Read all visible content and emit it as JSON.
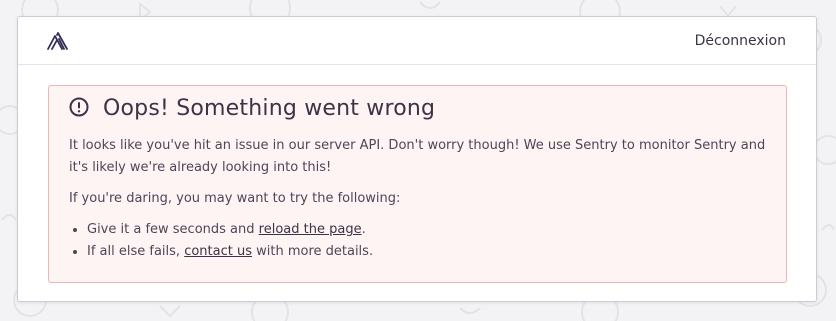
{
  "header": {
    "logo_icon": "sentry-logo-icon",
    "logout_label": "Déconnexion"
  },
  "alert": {
    "icon": "exclamation-circle-icon",
    "title": "Oops! Something went wrong",
    "paragraph1": "It looks like you've hit an issue in our server API. Don't worry though! We use Sentry to monitor Sentry and it's likely we're already looking into this!",
    "paragraph2": "If you're daring, you may want to try the following:",
    "items": [
      {
        "before": "Give it a few seconds and ",
        "link": "reload the page",
        "after": "."
      },
      {
        "before": "If all else fails, ",
        "link": "contact us",
        "after": " with more details."
      }
    ]
  },
  "colors": {
    "background": "#f3f2f4",
    "card": "#ffffff",
    "alert_bg": "#fdf4f3",
    "alert_border": "#e8b7b0",
    "text": "#4a3f55"
  }
}
